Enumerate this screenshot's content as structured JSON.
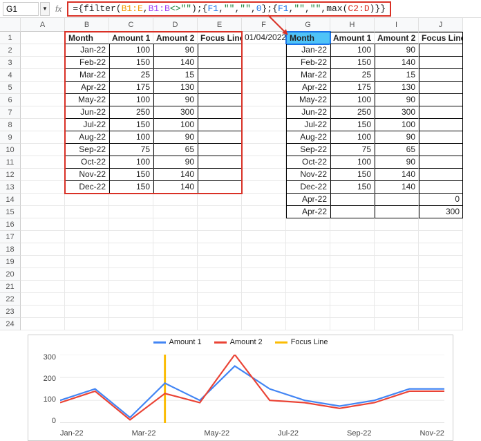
{
  "namebox": "G1",
  "formula_segments": [
    {
      "t": "={",
      "c": "#222"
    },
    {
      "t": "filter",
      "c": "#222"
    },
    {
      "t": "(",
      "c": "#222"
    },
    {
      "t": "B1:E",
      "c": "#f29900"
    },
    {
      "t": ",",
      "c": "#222"
    },
    {
      "t": "B1:B",
      "c": "#a142f4"
    },
    {
      "t": "<>\"\"",
      "c": "#188038"
    },
    {
      "t": ");{",
      "c": "#222"
    },
    {
      "t": "F1",
      "c": "#1a73e8"
    },
    {
      "t": ",",
      "c": "#222"
    },
    {
      "t": "\"\"",
      "c": "#188038"
    },
    {
      "t": ",",
      "c": "#222"
    },
    {
      "t": "\"\"",
      "c": "#188038"
    },
    {
      "t": ",",
      "c": "#222"
    },
    {
      "t": "0",
      "c": "#1a73e8"
    },
    {
      "t": "};{",
      "c": "#222"
    },
    {
      "t": "F1",
      "c": "#1a73e8"
    },
    {
      "t": ",",
      "c": "#222"
    },
    {
      "t": "\"\"",
      "c": "#188038"
    },
    {
      "t": ",",
      "c": "#222"
    },
    {
      "t": "\"\"",
      "c": "#188038"
    },
    {
      "t": ",",
      "c": "#222"
    },
    {
      "t": "max",
      "c": "#222"
    },
    {
      "t": "(",
      "c": "#222"
    },
    {
      "t": "C2:D",
      "c": "#d93025"
    },
    {
      "t": ")}}",
      "c": "#222"
    }
  ],
  "columns": [
    "A",
    "B",
    "C",
    "D",
    "E",
    "F",
    "G",
    "H",
    "I",
    "J"
  ],
  "row_count": 24,
  "left": {
    "headers": [
      "Month",
      "Amount 1",
      "Amount 2",
      "Focus Line"
    ],
    "rows": [
      {
        "m": "Jan-22",
        "a1": "100",
        "a2": "90"
      },
      {
        "m": "Feb-22",
        "a1": "150",
        "a2": "140"
      },
      {
        "m": "Mar-22",
        "a1": "25",
        "a2": "15"
      },
      {
        "m": "Apr-22",
        "a1": "175",
        "a2": "130"
      },
      {
        "m": "May-22",
        "a1": "100",
        "a2": "90"
      },
      {
        "m": "Jun-22",
        "a1": "250",
        "a2": "300"
      },
      {
        "m": "Jul-22",
        "a1": "150",
        "a2": "100"
      },
      {
        "m": "Aug-22",
        "a1": "100",
        "a2": "90"
      },
      {
        "m": "Sep-22",
        "a1": "75",
        "a2": "65"
      },
      {
        "m": "Oct-22",
        "a1": "100",
        "a2": "90"
      },
      {
        "m": "Nov-22",
        "a1": "150",
        "a2": "140"
      },
      {
        "m": "Dec-22",
        "a1": "150",
        "a2": "140"
      }
    ]
  },
  "fcell": "01/04/2022",
  "right": {
    "headers": [
      "Month",
      "Amount 1",
      "Amount 2",
      "Focus Line"
    ],
    "rows": [
      {
        "m": "Jan-22",
        "a1": "100",
        "a2": "90",
        "f": ""
      },
      {
        "m": "Feb-22",
        "a1": "150",
        "a2": "140",
        "f": ""
      },
      {
        "m": "Mar-22",
        "a1": "25",
        "a2": "15",
        "f": ""
      },
      {
        "m": "Apr-22",
        "a1": "175",
        "a2": "130",
        "f": ""
      },
      {
        "m": "May-22",
        "a1": "100",
        "a2": "90",
        "f": ""
      },
      {
        "m": "Jun-22",
        "a1": "250",
        "a2": "300",
        "f": ""
      },
      {
        "m": "Jul-22",
        "a1": "150",
        "a2": "100",
        "f": ""
      },
      {
        "m": "Aug-22",
        "a1": "100",
        "a2": "90",
        "f": ""
      },
      {
        "m": "Sep-22",
        "a1": "75",
        "a2": "65",
        "f": ""
      },
      {
        "m": "Oct-22",
        "a1": "100",
        "a2": "90",
        "f": ""
      },
      {
        "m": "Nov-22",
        "a1": "150",
        "a2": "140",
        "f": ""
      },
      {
        "m": "Dec-22",
        "a1": "150",
        "a2": "140",
        "f": ""
      },
      {
        "m": "Apr-22",
        "a1": "",
        "a2": "",
        "f": "0"
      },
      {
        "m": "Apr-22",
        "a1": "",
        "a2": "",
        "f": "300"
      }
    ]
  },
  "chart_data": {
    "type": "line",
    "categories": [
      "Jan-22",
      "Feb-22",
      "Mar-22",
      "Apr-22",
      "May-22",
      "Jun-22",
      "Jul-22",
      "Aug-22",
      "Sep-22",
      "Oct-22",
      "Nov-22",
      "Dec-22"
    ],
    "series": [
      {
        "name": "Amount 1",
        "color": "#4285f4",
        "values": [
          100,
          150,
          25,
          175,
          100,
          250,
          150,
          100,
          75,
          100,
          150,
          150
        ]
      },
      {
        "name": "Amount 2",
        "color": "#ea4335",
        "values": [
          90,
          140,
          15,
          130,
          90,
          300,
          100,
          90,
          65,
          90,
          140,
          140
        ]
      },
      {
        "name": "Focus Line",
        "color": "#fbbc04",
        "x_cat": "Apr-22",
        "y": [
          0,
          300
        ]
      }
    ],
    "ylim": [
      0,
      300
    ],
    "yticks": [
      0,
      100,
      200,
      300
    ],
    "xticks_shown": [
      "Jan-22",
      "Mar-22",
      "May-22",
      "Jul-22",
      "Sep-22",
      "Nov-22"
    ]
  }
}
